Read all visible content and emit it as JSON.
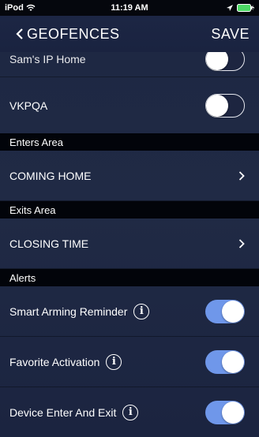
{
  "status_bar": {
    "device": "iPod",
    "time": "11:19 AM"
  },
  "nav": {
    "back_label": "GEOFENCES",
    "save_label": "SAVE"
  },
  "rows": {
    "partial_label": "Sam's IP Home",
    "vkpqa_label": "VKPQA",
    "vkpqa_toggle": "off"
  },
  "sections": {
    "enters_area": "Enters Area",
    "exits_area": "Exits Area",
    "alerts": "Alerts"
  },
  "enters_item": "COMING HOME",
  "exits_item": "CLOSING TIME",
  "alerts": [
    {
      "label": "Smart Arming Reminder",
      "state": "on"
    },
    {
      "label": "Favorite Activation",
      "state": "on"
    },
    {
      "label": "Device Enter And Exit",
      "state": "on"
    }
  ],
  "info_glyph": "i",
  "colors": {
    "toggle_on": "#6f97ea",
    "background": "#1e2843",
    "section_header": "#02040a"
  }
}
